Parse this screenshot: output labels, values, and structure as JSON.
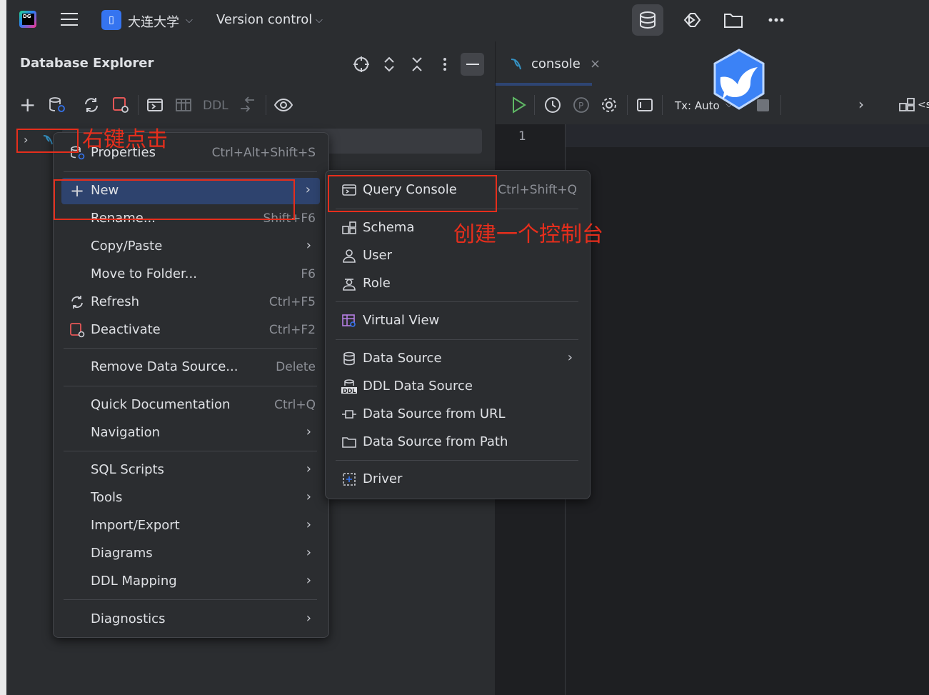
{
  "topbar": {
    "app_icon_text": "DG",
    "project_badge": "▯",
    "project_name": "大连大学",
    "vcs_label": "Version control"
  },
  "left_panel": {
    "title": "Database Explorer",
    "toolbar_ddl": "DDL"
  },
  "editor": {
    "tab_label": "console",
    "tx_label": "Tx: Auto",
    "line_number": "1",
    "right_trunc": "<s"
  },
  "annotations": {
    "right_click": "右键点击",
    "create_console": "创建一个控制台"
  },
  "context_menu": {
    "properties": {
      "label": "Properties",
      "shortcut": "Ctrl+Alt+Shift+S"
    },
    "new": {
      "label": "New"
    },
    "rename": {
      "label": "Rename...",
      "shortcut": "Shift+F6"
    },
    "copy_paste": {
      "label": "Copy/Paste"
    },
    "move": {
      "label": "Move to Folder...",
      "shortcut": "F6"
    },
    "refresh": {
      "label": "Refresh",
      "shortcut": "Ctrl+F5"
    },
    "deactivate": {
      "label": "Deactivate",
      "shortcut": "Ctrl+F2"
    },
    "remove": {
      "label": "Remove Data Source...",
      "shortcut": "Delete"
    },
    "quick_doc": {
      "label": "Quick Documentation",
      "shortcut": "Ctrl+Q"
    },
    "navigation": {
      "label": "Navigation"
    },
    "sql_scripts": {
      "label": "SQL Scripts"
    },
    "tools": {
      "label": "Tools"
    },
    "import_export": {
      "label": "Import/Export"
    },
    "diagrams": {
      "label": "Diagrams"
    },
    "ddl_mapping": {
      "label": "DDL Mapping"
    },
    "diagnostics": {
      "label": "Diagnostics"
    }
  },
  "submenu": {
    "query_console": {
      "label": "Query Console",
      "shortcut": "Ctrl+Shift+Q"
    },
    "schema": {
      "label": "Schema"
    },
    "user": {
      "label": "User"
    },
    "role": {
      "label": "Role"
    },
    "virtual_view": {
      "label": "Virtual View"
    },
    "data_source": {
      "label": "Data Source"
    },
    "ddl_data_source": {
      "label": "DDL Data Source"
    },
    "ds_url": {
      "label": "Data Source from URL"
    },
    "ds_path": {
      "label": "Data Source from Path"
    },
    "driver": {
      "label": "Driver"
    }
  },
  "colors": {
    "accent": "#3574f0",
    "annotation_red": "#e62e1c",
    "selected_row": "#2e436e"
  }
}
